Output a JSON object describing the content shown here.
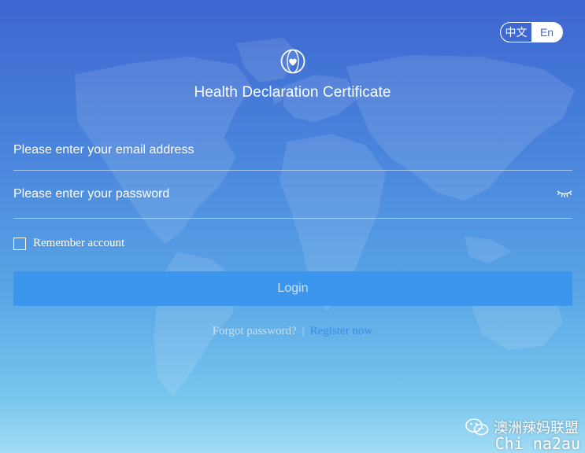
{
  "language_toggle": {
    "options": [
      "中文",
      "En"
    ],
    "selected": "中文"
  },
  "header": {
    "logo_icon": "globe-heart-icon",
    "title": "Health Declaration Certificate"
  },
  "form": {
    "email_placeholder": "Please enter your email address",
    "password_placeholder": "Please enter your password",
    "password_toggle_icon": "closed-eye-icon",
    "remember_label": "Remember account",
    "remember_checked": false,
    "login_label": "Login"
  },
  "links": {
    "forgot": "Forgot password?",
    "separator": "|",
    "register": "Register now"
  },
  "watermark": {
    "icon": "wechat-icon",
    "text": "澳洲辣妈联盟",
    "subtext": "Chi na2au"
  },
  "colors": {
    "background_top": "#3d66d0",
    "background_bottom": "#a3dcf4",
    "login_button": "#3d96ee",
    "register_link": "#3c8ce6",
    "toggle_active": "#3f68d1"
  }
}
